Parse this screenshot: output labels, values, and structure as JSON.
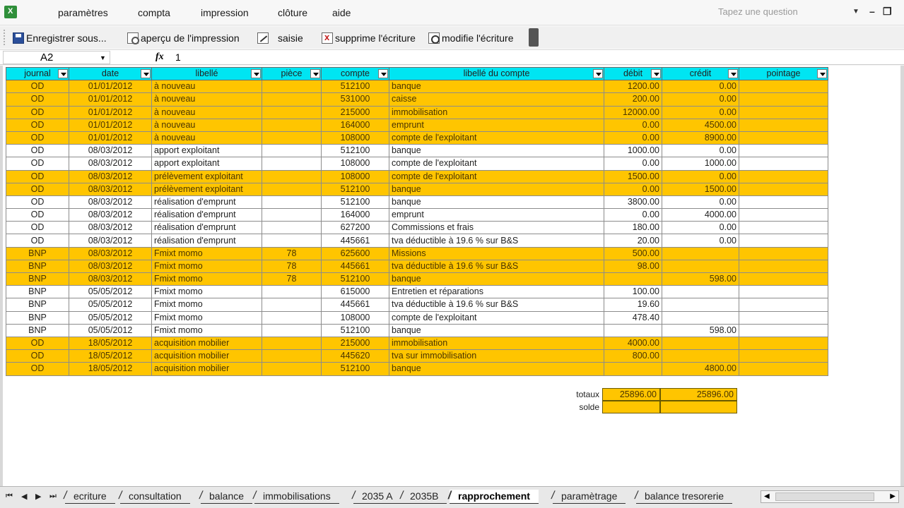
{
  "menu": [
    "paramètres",
    "compta",
    "impression",
    "clôture",
    "aide"
  ],
  "help_placeholder": "Tapez une question",
  "toolbar": {
    "save": "Enregistrer sous...",
    "preview": "aperçu de l'impression",
    "saisie": "saisie",
    "delete": "supprime l'écriture",
    "modify": "modifie l'écriture"
  },
  "formula": {
    "cell_ref": "A2",
    "fx": "fx",
    "value": "1"
  },
  "columns": [
    "journal",
    "date",
    "libellé",
    "pièce",
    "compte",
    "libellé du compte",
    "débit",
    "crédit",
    "pointage"
  ],
  "rows": [
    {
      "hl": true,
      "journal": "OD",
      "date": "01/01/2012",
      "libelle": "à nouveau",
      "piece": "",
      "compte": "512100",
      "libcompte": "banque",
      "debit": "1200.00",
      "credit": "0.00"
    },
    {
      "hl": true,
      "journal": "OD",
      "date": "01/01/2012",
      "libelle": "à nouveau",
      "piece": "",
      "compte": "531000",
      "libcompte": "caisse",
      "debit": "200.00",
      "credit": "0.00"
    },
    {
      "hl": true,
      "journal": "OD",
      "date": "01/01/2012",
      "libelle": "à nouveau",
      "piece": "",
      "compte": "215000",
      "libcompte": "immobilisation",
      "debit": "12000.00",
      "credit": "0.00"
    },
    {
      "hl": true,
      "journal": "OD",
      "date": "01/01/2012",
      "libelle": "à nouveau",
      "piece": "",
      "compte": "164000",
      "libcompte": "emprunt",
      "debit": "0.00",
      "credit": "4500.00"
    },
    {
      "hl": true,
      "journal": "OD",
      "date": "01/01/2012",
      "libelle": "à nouveau",
      "piece": "",
      "compte": "108000",
      "libcompte": "compte de l'exploitant",
      "debit": "0.00",
      "credit": "8900.00"
    },
    {
      "hl": false,
      "journal": "OD",
      "date": "08/03/2012",
      "libelle": "apport exploitant",
      "piece": "",
      "compte": "512100",
      "libcompte": "banque",
      "debit": "1000.00",
      "credit": "0.00"
    },
    {
      "hl": false,
      "journal": "OD",
      "date": "08/03/2012",
      "libelle": "apport exploitant",
      "piece": "",
      "compte": "108000",
      "libcompte": "compte de l'exploitant",
      "debit": "0.00",
      "credit": "1000.00"
    },
    {
      "hl": true,
      "journal": "OD",
      "date": "08/03/2012",
      "libelle": "prélèvement exploitant",
      "piece": "",
      "compte": "108000",
      "libcompte": "compte de l'exploitant",
      "debit": "1500.00",
      "credit": "0.00"
    },
    {
      "hl": true,
      "journal": "OD",
      "date": "08/03/2012",
      "libelle": "prélèvement exploitant",
      "piece": "",
      "compte": "512100",
      "libcompte": "banque",
      "debit": "0.00",
      "credit": "1500.00"
    },
    {
      "hl": false,
      "journal": "OD",
      "date": "08/03/2012",
      "libelle": "réalisation d'emprunt",
      "piece": "",
      "compte": "512100",
      "libcompte": "banque",
      "debit": "3800.00",
      "credit": "0.00"
    },
    {
      "hl": false,
      "journal": "OD",
      "date": "08/03/2012",
      "libelle": "réalisation d'emprunt",
      "piece": "",
      "compte": "164000",
      "libcompte": "emprunt",
      "debit": "0.00",
      "credit": "4000.00"
    },
    {
      "hl": false,
      "journal": "OD",
      "date": "08/03/2012",
      "libelle": "réalisation d'emprunt",
      "piece": "",
      "compte": "627200",
      "libcompte": "Commissions et frais",
      "debit": "180.00",
      "credit": "0.00"
    },
    {
      "hl": false,
      "journal": "OD",
      "date": "08/03/2012",
      "libelle": "réalisation d'emprunt",
      "piece": "",
      "compte": "445661",
      "libcompte": "tva déductible à 19.6 % sur B&S",
      "debit": "20.00",
      "credit": "0.00"
    },
    {
      "hl": true,
      "journal": "BNP",
      "date": "08/03/2012",
      "libelle": "Fmixt momo",
      "piece": "78",
      "compte": "625600",
      "libcompte": "Missions",
      "debit": "500.00",
      "credit": ""
    },
    {
      "hl": true,
      "journal": "BNP",
      "date": "08/03/2012",
      "libelle": "Fmixt momo",
      "piece": "78",
      "compte": "445661",
      "libcompte": "tva déductible à 19.6 % sur B&S",
      "debit": "98.00",
      "credit": ""
    },
    {
      "hl": true,
      "journal": "BNP",
      "date": "08/03/2012",
      "libelle": "Fmixt momo",
      "piece": "78",
      "compte": "512100",
      "libcompte": "banque",
      "debit": "",
      "credit": "598.00"
    },
    {
      "hl": false,
      "journal": "BNP",
      "date": "05/05/2012",
      "libelle": "Fmixt momo",
      "piece": "",
      "compte": "615000",
      "libcompte": "Entretien et réparations",
      "debit": "100.00",
      "credit": ""
    },
    {
      "hl": false,
      "journal": "BNP",
      "date": "05/05/2012",
      "libelle": "Fmixt momo",
      "piece": "",
      "compte": "445661",
      "libcompte": "tva déductible à 19.6 % sur B&S",
      "debit": "19.60",
      "credit": ""
    },
    {
      "hl": false,
      "journal": "BNP",
      "date": "05/05/2012",
      "libelle": "Fmixt momo",
      "piece": "",
      "compte": "108000",
      "libcompte": "compte de l'exploitant",
      "debit": "478.40",
      "credit": ""
    },
    {
      "hl": false,
      "journal": "BNP",
      "date": "05/05/2012",
      "libelle": "Fmixt momo",
      "piece": "",
      "compte": "512100",
      "libcompte": "banque",
      "debit": "",
      "credit": "598.00"
    },
    {
      "hl": true,
      "journal": "OD",
      "date": "18/05/2012",
      "libelle": "acquisition mobilier",
      "piece": "",
      "compte": "215000",
      "libcompte": "immobilisation",
      "debit": "4000.00",
      "credit": ""
    },
    {
      "hl": true,
      "journal": "OD",
      "date": "18/05/2012",
      "libelle": "acquisition mobilier",
      "piece": "",
      "compte": "445620",
      "libcompte": "tva sur immobilisation",
      "debit": "800.00",
      "credit": ""
    },
    {
      "hl": true,
      "journal": "OD",
      "date": "18/05/2012",
      "libelle": "acquisition mobilier",
      "piece": "",
      "compte": "512100",
      "libcompte": "banque",
      "debit": "",
      "credit": "4800.00"
    }
  ],
  "totals": {
    "label": "totaux",
    "debit": "25896.00",
    "credit": "25896.00"
  },
  "solde": {
    "label": "solde",
    "debit": "",
    "credit": ""
  },
  "tabs": [
    "ecriture",
    "consultation",
    "balance",
    "immobilisations",
    "2035 A",
    "2035B",
    "rapprochement",
    "paramètrage",
    "balance tresorerie"
  ],
  "active_tab": "rapprochement"
}
